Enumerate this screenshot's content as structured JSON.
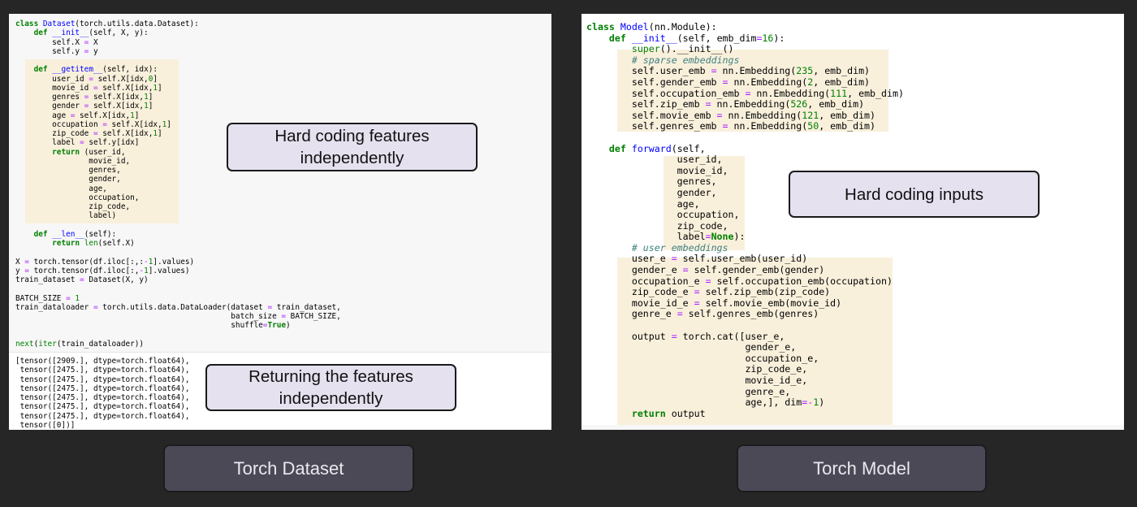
{
  "dataset_panel": {
    "code_lines": [
      "class Dataset(torch.utils.data.Dataset):",
      "    def __init__(self, X, y):",
      "        self.X = X",
      "        self.y = y",
      "",
      "    def __getitem__(self, idx):",
      "        user_id = self.X[idx,0]",
      "        movie_id = self.X[idx,1]",
      "        genres = self.X[idx,1]",
      "        gender = self.X[idx,1]",
      "        age = self.X[idx,1]",
      "        occupation = self.X[idx,1]",
      "        zip_code = self.X[idx,1]",
      "        label = self.y[idx]",
      "        return (user_id,",
      "                movie_id,",
      "                genres,",
      "                gender,",
      "                age,",
      "                occupation,",
      "                zip_code,",
      "                label)",
      "",
      "    def __len__(self):",
      "        return len(self.X)",
      "",
      "X = torch.tensor(df.iloc[:,:-1].values)",
      "y = torch.tensor(df.iloc[:,-1].values)",
      "train_dataset = Dataset(X, y)",
      "",
      "BATCH_SIZE = 1",
      "train_dataloader = torch.utils.data.DataLoader(dataset = train_dataset,",
      "                                               batch_size = BATCH_SIZE,",
      "                                               shuffle=True)",
      "",
      "next(iter(train_dataloader))"
    ],
    "output_lines": [
      "[tensor([2909.], dtype=torch.float64),",
      " tensor([2475.], dtype=torch.float64),",
      " tensor([2475.], dtype=torch.float64),",
      " tensor([2475.], dtype=torch.float64),",
      " tensor([2475.], dtype=torch.float64),",
      " tensor([2475.], dtype=torch.float64),",
      " tensor([2475.], dtype=torch.float64),",
      " tensor([0])]"
    ],
    "callout_top": "Hard coding features\nindependently",
    "callout_bottom": "Returning the features\nindependently",
    "caption": "Torch Dataset"
  },
  "model_panel": {
    "code_lines": [
      "class Model(nn.Module):",
      "    def __init__(self, emb_dim=16):",
      "        super().__init__()",
      "        # sparse embeddings",
      "        self.user_emb = nn.Embedding(235, emb_dim)",
      "        self.gender_emb = nn.Embedding(2, emb_dim)",
      "        self.occupation_emb = nn.Embedding(111, emb_dim)",
      "        self.zip_emb = nn.Embedding(526, emb_dim)",
      "        self.movie_emb = nn.Embedding(121, emb_dim)",
      "        self.genres_emb = nn.Embedding(50, emb_dim)",
      "",
      "    def forward(self,",
      "                user_id,",
      "                movie_id,",
      "                genres,",
      "                gender,",
      "                age,",
      "                occupation,",
      "                zip_code,",
      "                label=None):",
      "        # user embeddings",
      "        user_e = self.user_emb(user_id)",
      "        gender_e = self.gender_emb(gender)",
      "        occupation_e = self.occupation_emb(occupation)",
      "        zip_code_e = self.zip_emb(zip_code)",
      "        movie_id_e = self.movie_emb(movie_id)",
      "        genre_e = self.genres_emb(genres)",
      "",
      "        output = torch.cat([user_e,",
      "                            gender_e,",
      "                            occupation_e,",
      "                            zip_code_e,",
      "                            movie_id_e,",
      "                            genre_e,",
      "                            age,], dim=-1)",
      "        return output"
    ],
    "callout": "Hard coding inputs",
    "caption": "Torch Model"
  },
  "colors": {
    "background": "#262626",
    "highlight": "#f9f0dc",
    "callout_fill": "#e5e1ef",
    "caption_fill": "#4c4957",
    "keyword": "#008000",
    "function_name": "#0000ff",
    "operator": "#aa22ff",
    "comment": "#408080"
  }
}
